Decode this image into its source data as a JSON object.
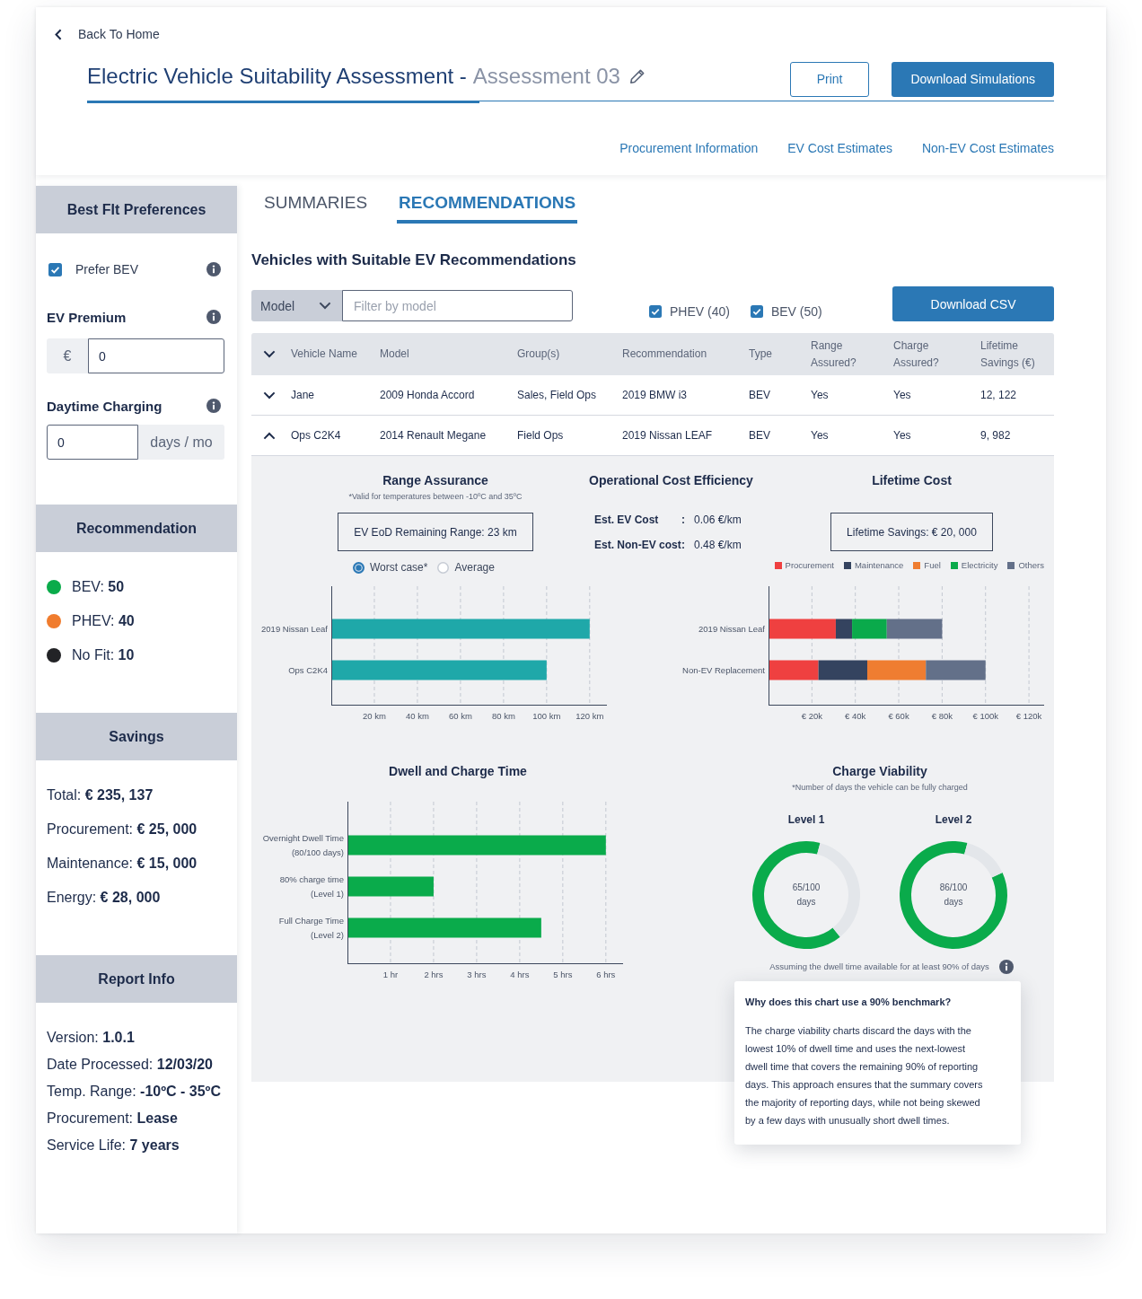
{
  "header": {
    "back_link": "Back To Home",
    "title": "Electric Vehicle Suitability Assessment -",
    "assessment_name": "Assessment 03",
    "buttons": [
      {
        "label": "Print",
        "kind": "outline"
      },
      {
        "label": "Download Simulations",
        "kind": "primary"
      }
    ],
    "links": [
      "Procurement Information",
      "EV Cost Estimates",
      "Non-EV Cost Estimates"
    ]
  },
  "sidebar": {
    "preferences": {
      "title": "Best FIt Preferences",
      "prefer_bev": {
        "label": "Prefer BEV",
        "checked": true
      },
      "ev_premium": {
        "label": "EV Premium",
        "prefix": "€",
        "value": "0"
      },
      "daytime_charging": {
        "label": "Daytime Charging",
        "value": "0",
        "suffix": "days / mo"
      }
    },
    "recommendation": {
      "title": "Recommendation",
      "items": [
        {
          "text": "BEV: **50**",
          "color": "#0aab4a"
        },
        {
          "text": "PHEV: **40**",
          "color": "#f07c2e"
        },
        {
          "text": "No Fit: **10**",
          "color": "#222326"
        }
      ]
    },
    "savings": {
      "title": "Savings",
      "lines": [
        "Total: **€ 235, 137**",
        "Procurement: **€ 25, 000**",
        "Maintenance: **€ 15, 000**",
        "Energy: **€ 28, 000**"
      ]
    },
    "report_info": {
      "title": "Report Info",
      "lines": [
        "Version: **1.0.1**",
        "Date Processed: **12/03/20**",
        "Temp. Range: **-10ºC - 35ºC**",
        "Procurement: **Lease**",
        "Service Life: **7 years**"
      ]
    }
  },
  "tabs": [
    {
      "label": "SUMMARIES",
      "selected": false
    },
    {
      "label": "RECOMMENDATIONS",
      "selected": true
    }
  ],
  "recommendations": {
    "heading": "Vehicles with Suitable EV Recommendations",
    "filter": {
      "dropdown": "Model",
      "placeholder": "Filter by model"
    },
    "type_filters": [
      {
        "label": "PHEV (40)",
        "checked": true
      },
      {
        "label": "BEV (50)",
        "checked": true
      }
    ],
    "download_button": "Download CSV",
    "table": {
      "columns": [
        "Vehicle Name",
        "Model",
        "Group(s)",
        "Recommendation",
        "Type",
        "Range Assured?",
        "Charge Assured?",
        "Lifetime Savings (€)"
      ],
      "rows": [
        {
          "expanded": false,
          "cells": [
            "Jane",
            "2009 Honda Accord",
            "Sales, Field Ops",
            "2019 BMW i3",
            "BEV",
            "Yes",
            "Yes",
            "12, 122"
          ]
        },
        {
          "expanded": true,
          "cells": [
            "Ops C2K4",
            "2014 Renault Megane",
            "Field Ops",
            "2019 Nissan LEAF",
            "BEV",
            "Yes",
            "Yes",
            "9, 982"
          ],
          "detail": {
            "sections": [
              {
                "kind": "range",
                "title": "Range Assurance",
                "note": "*Valid for temperatures between -10ºC and 35ºC",
                "callout": "EV EoD Remaining Range: 23 km",
                "options": [
                  {
                    "label": "Worst case*",
                    "selected": true
                  },
                  {
                    "label": "Average",
                    "selected": false
                  }
                ],
                "chart_data": {
                  "type": "bar",
                  "orientation": "horizontal",
                  "grid": true,
                  "categories": [
                    "2019 Nissan Leaf",
                    "Ops C2K4"
                  ],
                  "values": [
                    120,
                    100
                  ],
                  "xlim": [
                    0,
                    128
                  ],
                  "xticks": [
                    {
                      "value": 20,
                      "label": "20 km"
                    },
                    {
                      "value": 40,
                      "label": "40 km"
                    },
                    {
                      "value": 60,
                      "label": "60 km"
                    },
                    {
                      "value": 80,
                      "label": "80 km"
                    },
                    {
                      "value": 100,
                      "label": "100 km"
                    },
                    {
                      "value": 120,
                      "label": "120 km"
                    }
                  ]
                }
              },
              {
                "kind": "operational_cost",
                "title": "Operational Cost Efficiency",
                "rows": [
                  {
                    "label": "Est. EV Cost",
                    "separator": ":",
                    "value": "0.06 €/km"
                  },
                  {
                    "label": "Est. Non-EV cost",
                    "separator": ":",
                    "value": "0.48 €/km"
                  }
                ]
              },
              {
                "kind": "lifetime_cost",
                "title": "Lifetime Cost",
                "callout": "Lifetime Savings: € 20, 000",
                "chart_data": {
                  "type": "bar",
                  "orientation": "horizontal",
                  "stacked": true,
                  "grid": true,
                  "legend": "top",
                  "categories": [
                    "2019 Nissan Leaf",
                    "Non-EV Replacement"
                  ],
                  "series": [
                    {
                      "name": "Procurement",
                      "color": "#ef4040",
                      "values": [
                        31000,
                        23000
                      ]
                    },
                    {
                      "name": "Maintenance",
                      "color": "#34435f",
                      "values": [
                        7500,
                        22500
                      ]
                    },
                    {
                      "name": "Fuel",
                      "color": "#ef7d31",
                      "values": [
                        null,
                        27000
                      ]
                    },
                    {
                      "name": "Electricity",
                      "color": "#0aaa4b",
                      "values": [
                        16000,
                        null
                      ]
                    },
                    {
                      "name": "Others",
                      "color": "#637089",
                      "values": [
                        25500,
                        27500
                      ]
                    }
                  ],
                  "xlim": [
                    0,
                    127000
                  ],
                  "xticks": [
                    {
                      "value": 20000,
                      "label": "€ 20k"
                    },
                    {
                      "value": 40000,
                      "label": "€ 40k"
                    },
                    {
                      "value": 60000,
                      "label": "€ 60k"
                    },
                    {
                      "value": 80000,
                      "label": "€ 80k"
                    },
                    {
                      "value": 100000,
                      "label": "€ 100k"
                    },
                    {
                      "value": 120000,
                      "label": "€ 120k"
                    }
                  ]
                }
              },
              {
                "kind": "dwell",
                "title": "Dwell and Charge Time",
                "chart_data": {
                  "type": "bar",
                  "orientation": "horizontal",
                  "grid": true,
                  "categories": [
                    "Overnight Dwell Time (80/100 days)",
                    "80% charge time (Level 1)",
                    "Full Charge Time (Level 2)"
                  ],
                  "values": [
                    6,
                    2,
                    4.5
                  ],
                  "xlim": [
                    0,
                    6.4
                  ],
                  "xticks": [
                    {
                      "value": 1,
                      "label": "1 hr"
                    },
                    {
                      "value": 2,
                      "label": "2 hrs"
                    },
                    {
                      "value": 3,
                      "label": "3 hrs"
                    },
                    {
                      "value": 4,
                      "label": "4 hrs"
                    },
                    {
                      "value": 5,
                      "label": "5 hrs"
                    },
                    {
                      "value": 6,
                      "label": "6 hrs"
                    }
                  ]
                }
              },
              {
                "kind": "charge_viability",
                "title": "Charge Viability",
                "note": "*Number of days the vehicle can be fully charged",
                "rings": [
                  {
                    "chart_data": {
                      "type": "donut",
                      "title": "Level 1",
                      "values": [
                        65,
                        35
                      ]
                    },
                    "reading": "65/100",
                    "unit": "days"
                  },
                  {
                    "chart_data": {
                      "type": "donut",
                      "title": "Level 2",
                      "values": [
                        86,
                        14
                      ]
                    },
                    "reading": "86/100",
                    "unit": "days"
                  }
                ],
                "footnote": "Assuming the dwell time available for at least 90% of days",
                "tooltip": {
                  "title": "Why does this chart use a 90% benchmark?",
                  "body": "The charge viability charts discard the days with the lowest 10% of dwell time and uses the next-lowest dwell time that covers the remaining 90% of reporting days. This approach ensures that the summary covers the majority of reporting days, while not being skewed by a few days with unusually short dwell times."
                }
              }
            ]
          }
        }
      ]
    }
  }
}
